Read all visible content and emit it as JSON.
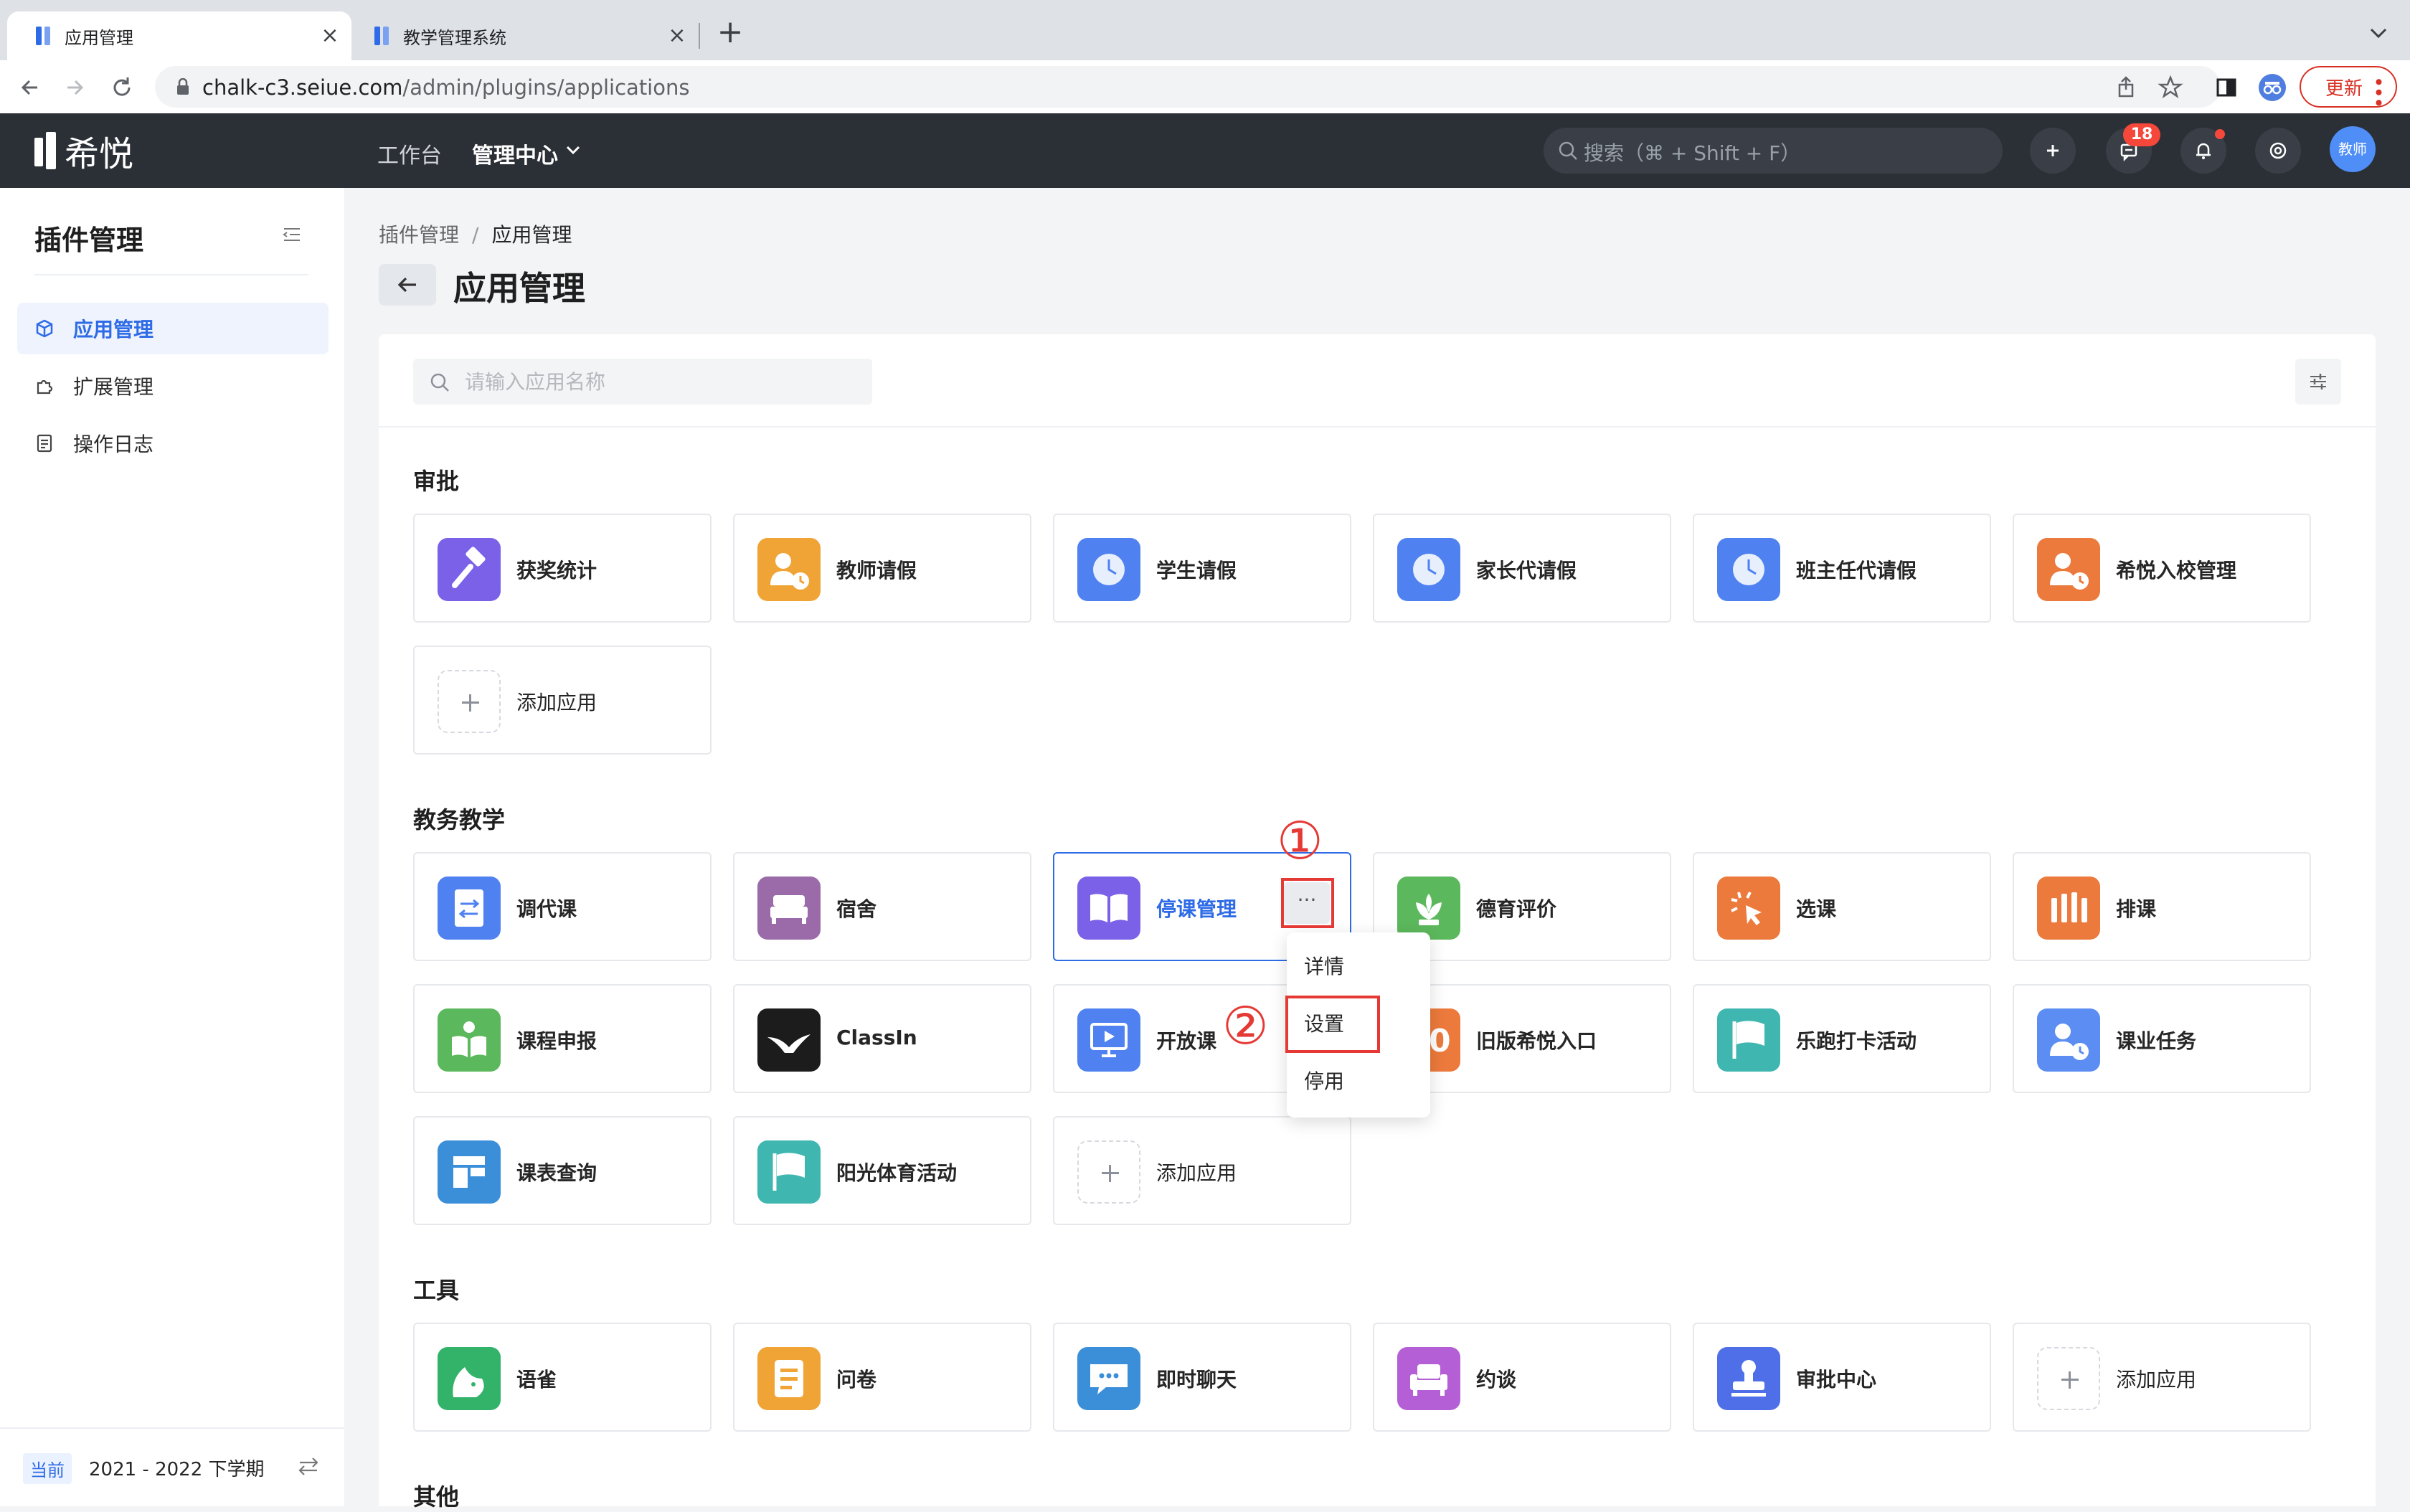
{
  "browser": {
    "tabs": [
      {
        "title": "应用管理",
        "active": true
      },
      {
        "title": "教学管理系统",
        "active": false
      }
    ],
    "url_host": "chalk-c3.seiue.com",
    "url_path": "/admin/plugins/applications",
    "update_label": "更新"
  },
  "header": {
    "brand": "希悦",
    "nav": {
      "workbench": "工作台",
      "admin_center": "管理中心"
    },
    "search_placeholder": "搜索（⌘ + Shift + F）",
    "message_badge": "18",
    "avatar_text": "教师"
  },
  "sidebar": {
    "title": "插件管理",
    "items": [
      {
        "label": "应用管理",
        "icon": "cube-icon",
        "active": true
      },
      {
        "label": "扩展管理",
        "icon": "puzzle-icon",
        "active": false
      },
      {
        "label": "操作日志",
        "icon": "log-icon",
        "active": false
      }
    ],
    "term_badge": "当前",
    "term_text": "2021 - 2022 下学期"
  },
  "main": {
    "breadcrumb": [
      "插件管理",
      "应用管理"
    ],
    "page_title": "应用管理",
    "search_placeholder": "请输入应用名称",
    "sections": [
      {
        "title": "审批",
        "apps": [
          "获奖统计",
          "教师请假",
          "学生请假",
          "家长代请假",
          "班主任代请假",
          "希悦入校管理"
        ],
        "add_label": "添加应用"
      },
      {
        "title": "教务教学",
        "apps": [
          "调代课",
          "宿舍",
          "停课管理",
          "德育评价",
          "选课",
          "排课",
          "课程申报",
          "ClassIn",
          "开放课",
          "旧版希悦入口",
          "乐跑打卡活动",
          "课业任务",
          "课表查询",
          "阳光体育活动"
        ],
        "add_label": "添加应用"
      },
      {
        "title": "工具",
        "apps": [
          "语雀",
          "问卷",
          "即时聊天",
          "约谈",
          "审批中心"
        ],
        "add_label": "添加应用"
      },
      {
        "title": "其他"
      }
    ],
    "more_button": "···",
    "context_menu": [
      "详情",
      "设置",
      "停用"
    ]
  },
  "annotations": {
    "step1": "①",
    "step2": "②"
  },
  "colors": {
    "accent": "#2e6be6",
    "annotation": "#e53935",
    "header_bg": "#2b2f36"
  }
}
